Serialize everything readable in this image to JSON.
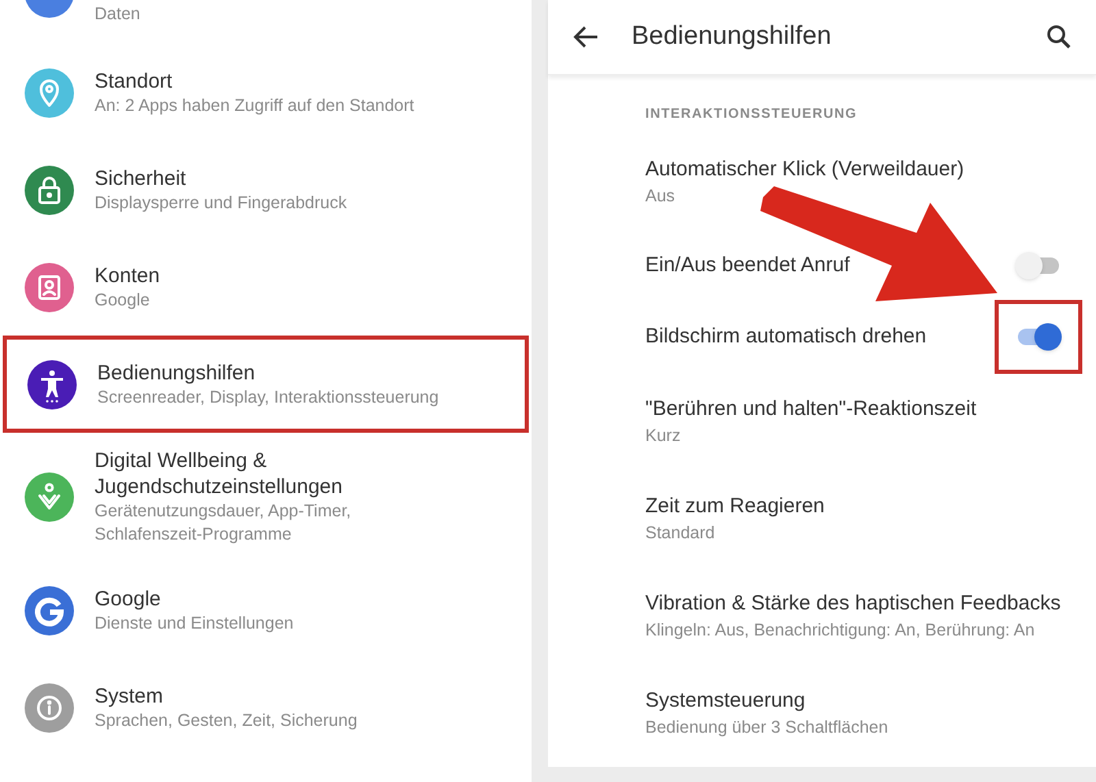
{
  "settings_list": {
    "items": [
      {
        "subtitle": "Daten",
        "color": "#4a7fe0",
        "highlighted": false
      },
      {
        "title": "Standort",
        "subtitle": "An: 2 Apps haben Zugriff auf den Standort",
        "color": "#4fbfdc",
        "highlighted": false
      },
      {
        "title": "Sicherheit",
        "subtitle": "Displaysperre und Fingerabdruck",
        "color": "#2f8a50",
        "highlighted": false
      },
      {
        "title": "Konten",
        "subtitle": "Google",
        "color": "#e0608f",
        "highlighted": false
      },
      {
        "title": "Bedienungshilfen",
        "subtitle": "Screenreader, Display, Interaktionssteuerung",
        "color": "#4a1db5",
        "highlighted": true
      },
      {
        "title": "Digital Wellbeing & Jugendschutzeinstellungen",
        "subtitle": "Gerätenutzungsdauer, App-Timer, Schlafenszeit-Programme",
        "color": "#4cb55a",
        "highlighted": false
      },
      {
        "title": "Google",
        "subtitle": "Dienste und Einstellungen",
        "color": "#3a6fd6",
        "highlighted": false
      },
      {
        "title": "System",
        "subtitle": "Sprachen, Gesten, Zeit, Sicherung",
        "color": "#9e9e9e",
        "highlighted": false
      }
    ]
  },
  "accessibility": {
    "title": "Bedienungshilfen",
    "section": "INTERAKTIONSSTEUERUNG",
    "items": [
      {
        "kind": "plain",
        "title": "Automatischer Klick (Verweildauer)",
        "subtitle": "Aus"
      },
      {
        "kind": "toggle",
        "title": "Ein/Aus beendet Anruf",
        "on": false,
        "highlighted": false
      },
      {
        "kind": "toggle",
        "title": "Bildschirm automatisch drehen",
        "on": true,
        "highlighted": true
      },
      {
        "kind": "plain",
        "title": "\"Berühren und halten\"-Reaktionszeit",
        "subtitle": "Kurz"
      },
      {
        "kind": "plain",
        "title": "Zeit zum Reagieren",
        "subtitle": "Standard"
      },
      {
        "kind": "plain",
        "title": "Vibration & Stärke des haptischen Feedbacks",
        "subtitle": "Klingeln: Aus, Benachrichtigung: An, Berührung: An"
      },
      {
        "kind": "plain",
        "title": "Systemsteuerung",
        "subtitle": "Bedienung über 3 Schaltflächen"
      }
    ]
  }
}
